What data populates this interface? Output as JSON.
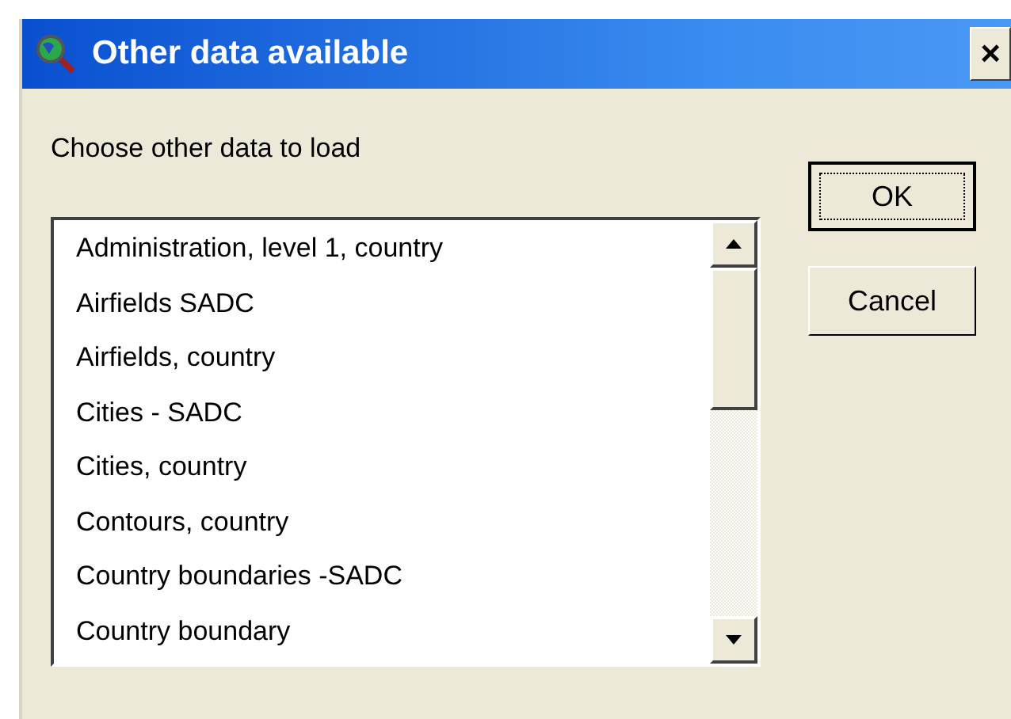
{
  "window": {
    "title": "Other data available",
    "close": "×"
  },
  "prompt": "Choose other data to load",
  "list": {
    "items": [
      {
        "label": "Administration, level 1, country"
      },
      {
        "label": "Airfields SADC"
      },
      {
        "label": "Airfields, country"
      },
      {
        "label": "Cities - SADC"
      },
      {
        "label": "Cities, country"
      },
      {
        "label": "Contours, country"
      },
      {
        "label": "Country boundaries -SADC"
      },
      {
        "label": "Country boundary"
      }
    ]
  },
  "buttons": [
    {
      "label": "OK",
      "default": true
    },
    {
      "label": "Cancel",
      "default": false
    }
  ]
}
